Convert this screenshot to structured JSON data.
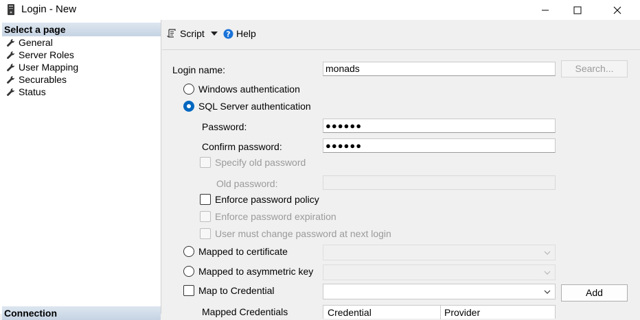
{
  "window": {
    "title": "Login - New",
    "minimize_label": "—",
    "maximize_label": "☐",
    "close_label": "✕"
  },
  "left_pane": {
    "select_header": "Select a page",
    "pages": [
      {
        "label": "General",
        "icon": "wrench-icon"
      },
      {
        "label": "Server Roles",
        "icon": "wrench-icon"
      },
      {
        "label": "User Mapping",
        "icon": "wrench-icon"
      },
      {
        "label": "Securables",
        "icon": "wrench-icon"
      },
      {
        "label": "Status",
        "icon": "wrench-icon"
      }
    ],
    "connection_header": "Connection"
  },
  "toolbar": {
    "script_label": "Script",
    "help_label": "Help"
  },
  "form": {
    "login_name_label": "Login name:",
    "login_name_value": "monads",
    "search_button": "Search...",
    "windows_auth_label": "Windows authentication",
    "sql_auth_label": "SQL Server authentication",
    "password_label": "Password:",
    "password_value": "●●●●●●",
    "confirm_password_label": "Confirm password:",
    "confirm_password_value": "●●●●●●",
    "specify_old_password_label": "Specify old password",
    "old_password_label": "Old password:",
    "old_password_value": "",
    "enforce_policy_label": "Enforce password policy",
    "enforce_expiration_label": "Enforce password expiration",
    "must_change_label": "User must change password at next login",
    "mapped_cert_label": "Mapped to certificate",
    "mapped_asym_label": "Mapped to asymmetric key",
    "map_credential_label": "Map to Credential",
    "add_button": "Add",
    "mapped_credentials_label": "Mapped Credentials",
    "grid_columns": [
      "Credential",
      "Provider"
    ]
  },
  "colors": {
    "accent": "#0067c0",
    "header_gradient_top": "#dde6f0",
    "header_gradient_bottom": "#c5d3e3",
    "disabled_text": "#9a9a9a"
  }
}
